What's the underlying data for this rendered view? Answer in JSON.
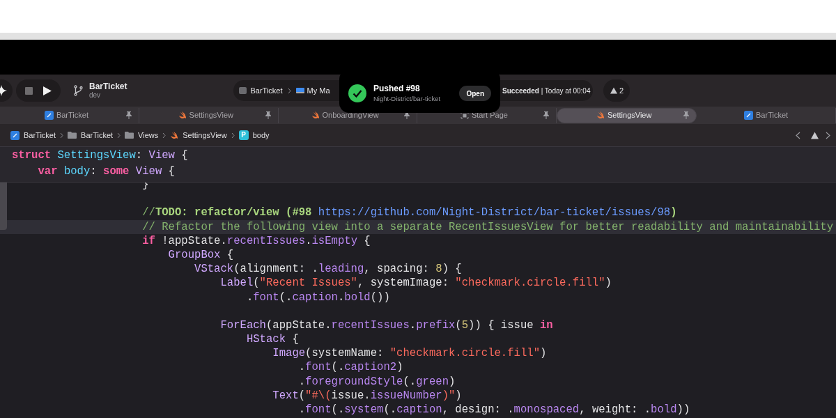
{
  "toolbar": {
    "project": "BarTicket",
    "branch": "dev",
    "scheme": [
      "BarTicket",
      "My Ma"
    ],
    "status": {
      "result": "Succeeded",
      "time": "| Today at 00:04"
    },
    "warnings": "2"
  },
  "notification": {
    "title": "Pushed #98",
    "subtitle": "Night-District/bar-ticket",
    "action": "Open"
  },
  "tabs": [
    {
      "label": "BarTicket",
      "kind": "project",
      "pinned": true,
      "selected": false
    },
    {
      "label": "SettingsView",
      "kind": "swift",
      "pinned": true,
      "selected": false
    },
    {
      "label": "OnboardingView",
      "kind": "swift",
      "pinned": true,
      "selected": false
    },
    {
      "label": "Start Page",
      "kind": "start",
      "pinned": true,
      "selected": false
    },
    {
      "label": "SettingsView",
      "kind": "swift",
      "pinned": true,
      "selected": true
    },
    {
      "label": "BarTicket",
      "kind": "project",
      "pinned": false,
      "selected": false
    }
  ],
  "breadcrumb": [
    {
      "label": "BarTicket",
      "kind": "project"
    },
    {
      "label": "BarTicket",
      "kind": "folder"
    },
    {
      "label": "Views",
      "kind": "folder"
    },
    {
      "label": "SettingsView",
      "kind": "swift"
    },
    {
      "label": "body",
      "kind": "property",
      "badge": "P"
    }
  ],
  "sticky_lines": [
    [
      {
        "kind": "kw",
        "text": "struct "
      },
      {
        "kind": "decl",
        "text": "SettingsView"
      },
      {
        "kind": "plain",
        "text": ": "
      },
      {
        "kind": "type",
        "text": "View"
      },
      {
        "kind": "plain",
        "text": " {"
      }
    ],
    [
      {
        "kind": "kw",
        "text": "    var "
      },
      {
        "kind": "decl",
        "text": "body"
      },
      {
        "kind": "plain",
        "text": ": "
      },
      {
        "kind": "kw",
        "text": "some "
      },
      {
        "kind": "type",
        "text": "View"
      },
      {
        "kind": "plain",
        "text": " {"
      }
    ]
  ],
  "lines": [
    {
      "kind": "code",
      "current": false,
      "tokens": [
        {
          "kind": "plain",
          "text": "                    }"
        }
      ]
    },
    {
      "kind": "blank"
    },
    {
      "kind": "code",
      "current": false,
      "tokens": [
        {
          "kind": "comment",
          "text": "                    //"
        },
        {
          "kind": "todo",
          "text": "TODO: refactor/view (#98 "
        },
        {
          "kind": "url",
          "text": "https://github.com/Night-District/bar-ticket/issues/98"
        },
        {
          "kind": "todo",
          "text": ")"
        }
      ]
    },
    {
      "kind": "code",
      "current": true,
      "tokens": [
        {
          "kind": "comment",
          "text": "                    // Refactor the following view into a separate RecentIssuesView for better readability and maintainability"
        }
      ]
    },
    {
      "kind": "code",
      "current": false,
      "tokens": [
        {
          "kind": "kw",
          "text": "                    if"
        },
        {
          "kind": "plain",
          "text": " !"
        },
        {
          "kind": "var",
          "text": "appState"
        },
        {
          "kind": "plain",
          "text": "."
        },
        {
          "kind": "prop",
          "text": "recentIssues"
        },
        {
          "kind": "plain",
          "text": "."
        },
        {
          "kind": "prop",
          "text": "isEmpty"
        },
        {
          "kind": "plain",
          "text": " {"
        }
      ]
    },
    {
      "kind": "code",
      "current": false,
      "tokens": [
        {
          "kind": "type",
          "text": "                        GroupBox"
        },
        {
          "kind": "plain",
          "text": " {"
        }
      ]
    },
    {
      "kind": "code",
      "current": false,
      "tokens": [
        {
          "kind": "type",
          "text": "                            VStack"
        },
        {
          "kind": "plain",
          "text": "(alignment: ."
        },
        {
          "kind": "prop",
          "text": "leading"
        },
        {
          "kind": "plain",
          "text": ", spacing: "
        },
        {
          "kind": "num",
          "text": "8"
        },
        {
          "kind": "plain",
          "text": ") {"
        }
      ]
    },
    {
      "kind": "code",
      "current": false,
      "tokens": [
        {
          "kind": "type",
          "text": "                                Label"
        },
        {
          "kind": "plain",
          "text": "("
        },
        {
          "kind": "str",
          "text": "\"Recent Issues\""
        },
        {
          "kind": "plain",
          "text": ", systemImage: "
        },
        {
          "kind": "str",
          "text": "\"checkmark.circle.fill\""
        },
        {
          "kind": "plain",
          "text": ")"
        }
      ]
    },
    {
      "kind": "code",
      "current": false,
      "tokens": [
        {
          "kind": "plain",
          "text": "                                    ."
        },
        {
          "kind": "prop",
          "text": "font"
        },
        {
          "kind": "plain",
          "text": "(."
        },
        {
          "kind": "prop",
          "text": "caption"
        },
        {
          "kind": "plain",
          "text": "."
        },
        {
          "kind": "prop",
          "text": "bold"
        },
        {
          "kind": "plain",
          "text": "())"
        }
      ]
    },
    {
      "kind": "blank"
    },
    {
      "kind": "code",
      "current": false,
      "tokens": [
        {
          "kind": "type",
          "text": "                                ForEach"
        },
        {
          "kind": "plain",
          "text": "("
        },
        {
          "kind": "var",
          "text": "appState"
        },
        {
          "kind": "plain",
          "text": "."
        },
        {
          "kind": "prop",
          "text": "recentIssues"
        },
        {
          "kind": "plain",
          "text": "."
        },
        {
          "kind": "prop",
          "text": "prefix"
        },
        {
          "kind": "plain",
          "text": "("
        },
        {
          "kind": "num",
          "text": "5"
        },
        {
          "kind": "plain",
          "text": ")) { issue "
        },
        {
          "kind": "kw",
          "text": "in"
        }
      ]
    },
    {
      "kind": "code",
      "current": false,
      "tokens": [
        {
          "kind": "type",
          "text": "                                    HStack"
        },
        {
          "kind": "plain",
          "text": " {"
        }
      ]
    },
    {
      "kind": "code",
      "current": false,
      "tokens": [
        {
          "kind": "type",
          "text": "                                        Image"
        },
        {
          "kind": "plain",
          "text": "(systemName: "
        },
        {
          "kind": "str",
          "text": "\"checkmark.circle.fill\""
        },
        {
          "kind": "plain",
          "text": ")"
        }
      ]
    },
    {
      "kind": "code",
      "current": false,
      "tokens": [
        {
          "kind": "plain",
          "text": "                                            ."
        },
        {
          "kind": "prop",
          "text": "font"
        },
        {
          "kind": "plain",
          "text": "(."
        },
        {
          "kind": "prop",
          "text": "caption2"
        },
        {
          "kind": "plain",
          "text": ")"
        }
      ]
    },
    {
      "kind": "code",
      "current": false,
      "tokens": [
        {
          "kind": "plain",
          "text": "                                            ."
        },
        {
          "kind": "prop",
          "text": "foregroundStyle"
        },
        {
          "kind": "plain",
          "text": "(."
        },
        {
          "kind": "prop",
          "text": "green"
        },
        {
          "kind": "plain",
          "text": ")"
        }
      ]
    },
    {
      "kind": "code",
      "current": false,
      "tokens": [
        {
          "kind": "type",
          "text": "                                        Text"
        },
        {
          "kind": "plain",
          "text": "("
        },
        {
          "kind": "str",
          "text": "\"#\\("
        },
        {
          "kind": "plain",
          "text": "issue."
        },
        {
          "kind": "prop",
          "text": "issueNumber"
        },
        {
          "kind": "str",
          "text": ")\""
        },
        {
          "kind": "plain",
          "text": ")"
        }
      ]
    },
    {
      "kind": "code",
      "current": false,
      "tokens": [
        {
          "kind": "plain",
          "text": "                                            ."
        },
        {
          "kind": "prop",
          "text": "font"
        },
        {
          "kind": "plain",
          "text": "(."
        },
        {
          "kind": "prop",
          "text": "system"
        },
        {
          "kind": "plain",
          "text": "(."
        },
        {
          "kind": "prop",
          "text": "caption"
        },
        {
          "kind": "plain",
          "text": ", design: ."
        },
        {
          "kind": "prop",
          "text": "monospaced"
        },
        {
          "kind": "plain",
          "text": ", weight: ."
        },
        {
          "kind": "prop",
          "text": "bold"
        },
        {
          "kind": "plain",
          "text": "))"
        }
      ]
    }
  ]
}
